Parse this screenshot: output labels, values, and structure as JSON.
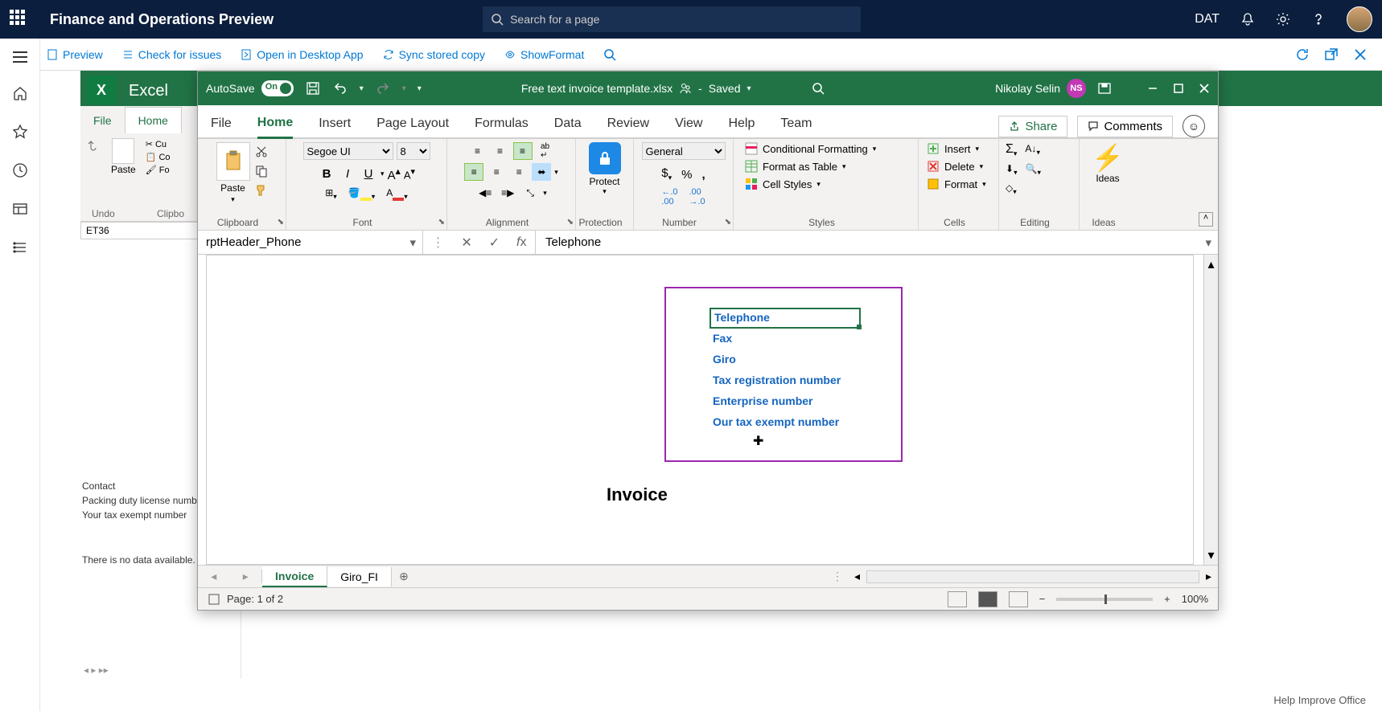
{
  "d365": {
    "title": "Finance and Operations Preview",
    "search_placeholder": "Search for a page",
    "company": "DAT"
  },
  "toolbar": {
    "preview": "Preview",
    "check_issues": "Check for issues",
    "open_desktop": "Open in Desktop App",
    "sync": "Sync stored copy",
    "show_format": "ShowFormat"
  },
  "bg_excel": {
    "app_name": "Excel",
    "file_tab": "File",
    "home_tab": "Home",
    "undo_label": "Undo",
    "clipboard_label": "Clipbo",
    "paste_label": "Paste",
    "cut_label": "Cu",
    "copy_label": "Co",
    "format_label": "Fo",
    "name_box": "ET36",
    "contact": "Contact",
    "packing": "Packing duty license number",
    "tax_exempt": "Your tax exempt number",
    "no_data": "There is no data available."
  },
  "excel_window": {
    "autosave_label": "AutoSave",
    "autosave_state": "On",
    "filename": "Free text invoice template.xlsx",
    "saved_state": "Saved",
    "user_name": "Nikolay Selin",
    "user_initials": "NS",
    "tabs": {
      "file": "File",
      "home": "Home",
      "insert": "Insert",
      "page_layout": "Page Layout",
      "formulas": "Formulas",
      "data": "Data",
      "review": "Review",
      "view": "View",
      "help": "Help",
      "team": "Team"
    },
    "share": "Share",
    "comments": "Comments",
    "ribbon": {
      "paste": "Paste",
      "clipboard": "Clipboard",
      "font_name": "Segoe UI",
      "font_size": "8",
      "font": "Font",
      "alignment": "Alignment",
      "protect": "Protect",
      "protection": "Protection",
      "number_format": "General",
      "number": "Number",
      "cond_format": "Conditional Formatting",
      "format_table": "Format as Table",
      "cell_styles": "Cell Styles",
      "styles": "Styles",
      "insert": "Insert",
      "delete": "Delete",
      "format": "Format",
      "cells": "Cells",
      "editing": "Editing",
      "ideas": "Ideas"
    },
    "name_box": "rptHeader_Phone",
    "formula_value": "Telephone",
    "sheet_fields": [
      "Telephone",
      "Fax",
      "Giro",
      "Tax registration number",
      "Enterprise number",
      "Our tax exempt number"
    ],
    "invoice_title": "Invoice",
    "sheet_tabs": {
      "invoice": "Invoice",
      "giro": "Giro_FI"
    },
    "page_info": "Page: 1 of 2",
    "zoom": "100%"
  },
  "footer": {
    "help": "Help Improve Office"
  }
}
